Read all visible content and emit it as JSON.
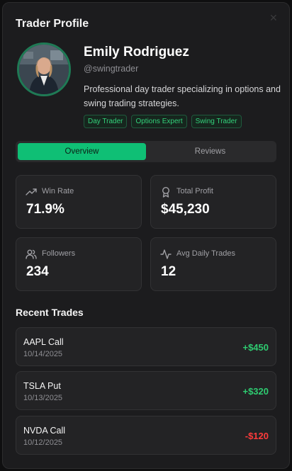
{
  "modal": {
    "title": "Trader Profile"
  },
  "profile": {
    "name": "Emily Rodriguez",
    "handle": "@swingtrader",
    "bio": "Professional day trader specializing in options and swing trading strategies.",
    "tags": [
      "Day Trader",
      "Options Expert",
      "Swing Trader"
    ]
  },
  "tabs": [
    {
      "label": "Overview",
      "active": true
    },
    {
      "label": "Reviews",
      "active": false
    }
  ],
  "stats": [
    {
      "label": "Win Rate",
      "value": "71.9%",
      "icon": "trending-up-icon"
    },
    {
      "label": "Total Profit",
      "value": "$45,230",
      "icon": "award-icon"
    },
    {
      "label": "Followers",
      "value": "234",
      "icon": "users-icon"
    },
    {
      "label": "Avg Daily Trades",
      "value": "12",
      "icon": "activity-icon"
    }
  ],
  "recent_trades": {
    "title": "Recent Trades",
    "items": [
      {
        "symbol": "AAPL Call",
        "date": "10/14/2025",
        "pnl": "+$450",
        "direction": "gain"
      },
      {
        "symbol": "TSLA Put",
        "date": "10/13/2025",
        "pnl": "+$320",
        "direction": "gain"
      },
      {
        "symbol": "NVDA Call",
        "date": "10/12/2025",
        "pnl": "-$120",
        "direction": "loss"
      }
    ]
  },
  "colors": {
    "accent": "#0fbf75",
    "gain": "#2ecc71",
    "loss": "#ff3b3b",
    "tag_text": "#33d17a"
  }
}
